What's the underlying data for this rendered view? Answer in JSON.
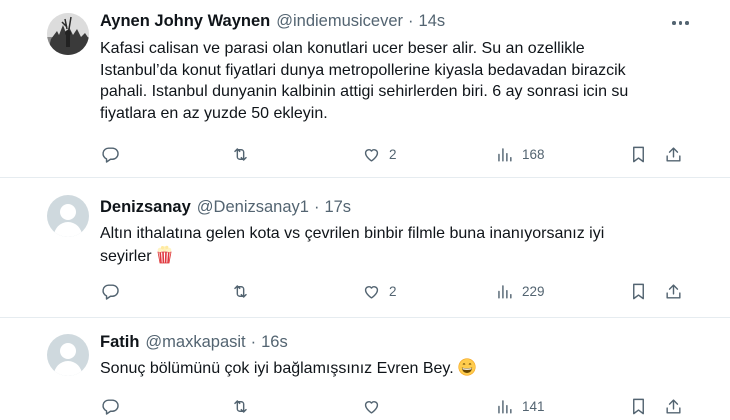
{
  "tweets": [
    {
      "name": "Aynen Johny Waynen",
      "handle": "@indiemusicever",
      "separator": "·",
      "time": "14s",
      "lines": [
        "Kafasi calisan ve parasi olan konutlari ucer beser alir. Su an ozellikle",
        "Istanbul’da konut fiyatlari dunya metropollerine kiyasla bedavadan birazcik",
        "pahali. Istanbul dunyanin kalbinin attigi sehirlerden biri. 6 ay sonrasi icin su",
        "fiyatlara en az yuzde 50 ekleyin."
      ],
      "replies": "",
      "retweets": "",
      "likes": "2",
      "views": "168"
    },
    {
      "name": "Denizsanay",
      "handle": "@Denizsanay1",
      "separator": "·",
      "time": "17s",
      "lines": [
        "Altın ithalatına gelen kota vs  çevrilen binbir filmle buna inanıyorsanız iyi",
        "seyirler"
      ],
      "emoji": "popcorn-emoji",
      "replies": "",
      "retweets": "",
      "likes": "2",
      "views": "229"
    },
    {
      "name": "Fatih",
      "handle": "@maxkapasit",
      "separator": "·",
      "time": "16s",
      "lines": [
        "Sonuç bölümünü çok iyi bağlamışsınız Evren Bey."
      ],
      "emoji": "grinning-face-emoji",
      "replies": "",
      "retweets": "",
      "likes": "",
      "views": "141"
    }
  ],
  "icons": {
    "reply": "reply-icon",
    "retweet": "retweet-icon",
    "like": "like-icon",
    "views": "views-icon",
    "bookmark": "bookmark-icon",
    "share": "share-icon",
    "more": "more-icon"
  },
  "colors": {
    "text": "#0f1419",
    "secondary": "#536471",
    "divider": "#e6ecf0",
    "default_avatar": "#cfd9de"
  }
}
